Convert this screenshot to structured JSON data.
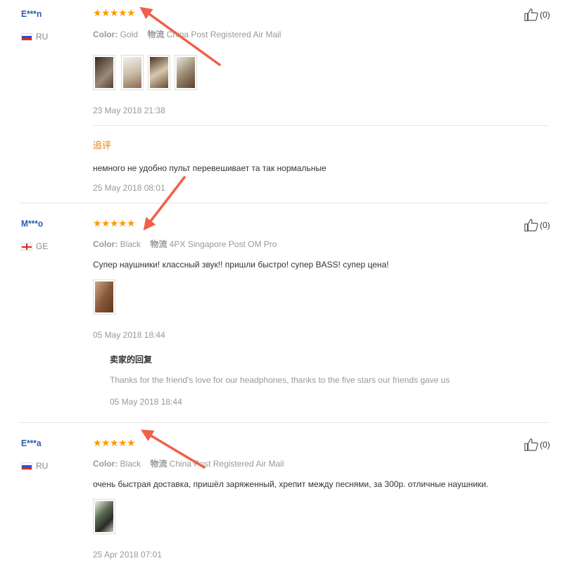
{
  "reviews": [
    {
      "user": "E***n",
      "country": "RU",
      "color_label": "Color:",
      "color_value": "Gold",
      "shipping_label": "物流",
      "shipping_value": "China Post Registered Air Mail",
      "date": "23 May 2018 21:38",
      "additional_title": "追评",
      "additional_feedback": "немного не удобно пульт перевешивает та так нормальные",
      "additional_date": "25 May 2018 08:01",
      "likes": "(0)",
      "rating": 5
    },
    {
      "user": "M***o",
      "country": "GE",
      "color_label": "Color:",
      "color_value": "Black",
      "shipping_label": "物流",
      "shipping_value": "4PX Singapore Post OM Pro",
      "feedback": "Супер наушники! классный звук!! пришли быстро! супер BASS! супер цена!",
      "date": "05 May 2018 18:44",
      "reply_title": "卖家的回复",
      "reply_text": "Thanks for the friend's love for our headphones, thanks to the five stars our friends gave us",
      "reply_date": "05 May 2018 18:44",
      "likes": "(0)",
      "rating": 5
    },
    {
      "user": "E***a",
      "country": "RU",
      "color_label": "Color:",
      "color_value": "Black",
      "shipping_label": "物流",
      "shipping_value": "China Post Registered Air Mail",
      "feedback": "очень быстрая доставка, пришёл заряженный, хрепит между песнями, за 300р. отличные наушники.",
      "date": "25 Apr 2018 07:01",
      "likes": "(0)",
      "rating": 5
    }
  ],
  "icons": {
    "star": "star-icon",
    "like": "thumbs-up-icon",
    "annotation": "red-arrow"
  },
  "colors": {
    "star": "#ff9900",
    "username": "#2a5db0",
    "additional_title": "#e67e00",
    "arrow": "#f0604a"
  }
}
